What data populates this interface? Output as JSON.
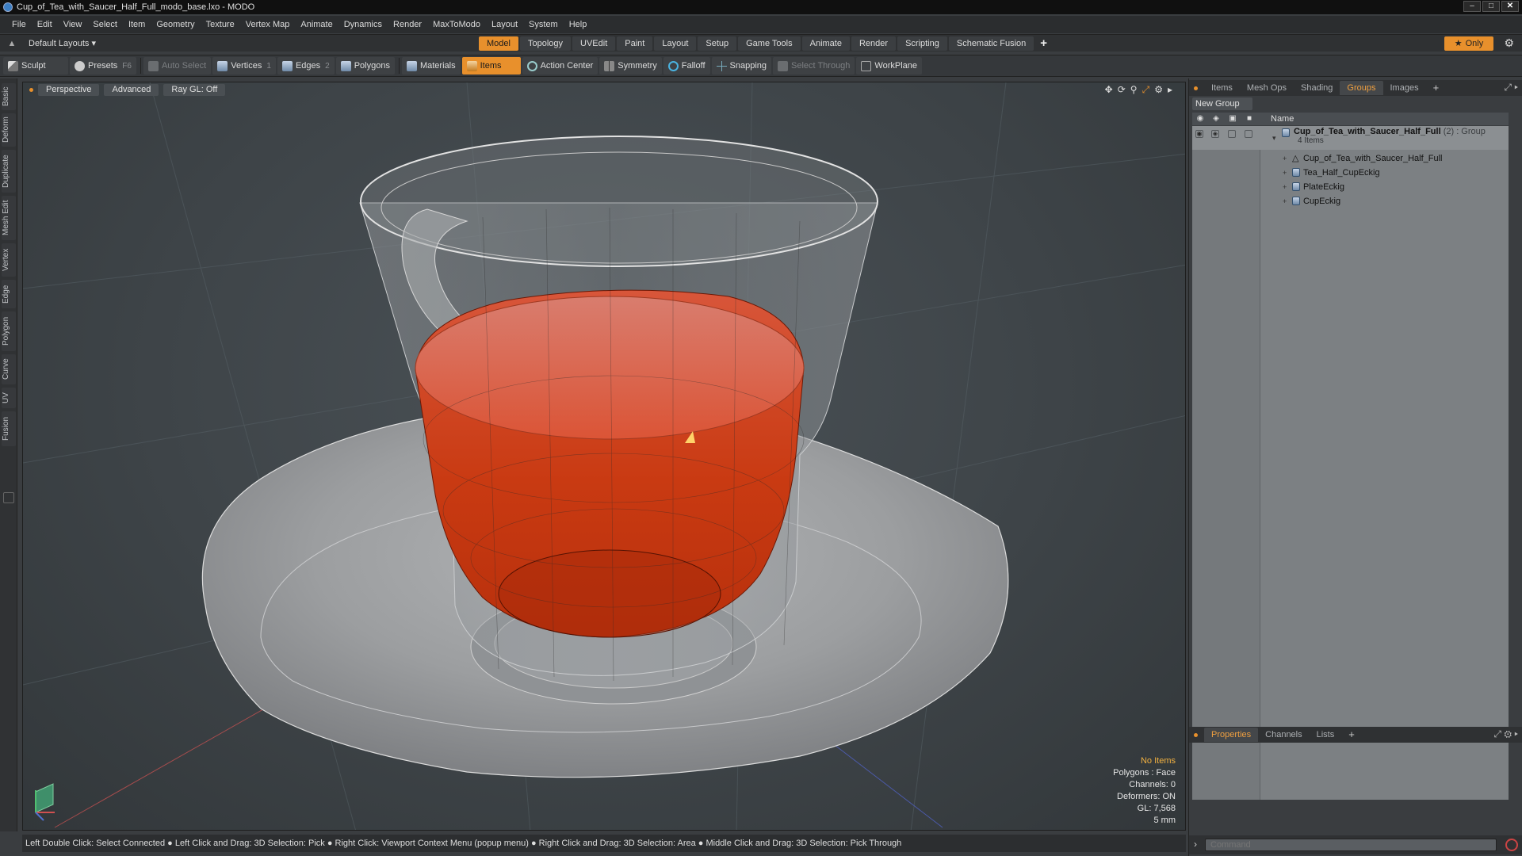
{
  "window": {
    "title": "Cup_of_Tea_with_Saucer_Half_Full_modo_base.lxo - MODO",
    "controls": [
      "–",
      "□",
      "✕"
    ]
  },
  "menubar": [
    "File",
    "Edit",
    "View",
    "Select",
    "Item",
    "Geometry",
    "Texture",
    "Vertex Map",
    "Animate",
    "Dynamics",
    "Render",
    "MaxToModo",
    "Layout",
    "System",
    "Help"
  ],
  "layout_selector": "Default Layouts ▾",
  "mode_tabs": [
    {
      "label": "Model",
      "active": true
    },
    {
      "label": "Topology",
      "active": false
    },
    {
      "label": "UVEdit",
      "active": false
    },
    {
      "label": "Paint",
      "active": false
    },
    {
      "label": "Layout",
      "active": false
    },
    {
      "label": "Setup",
      "active": false
    },
    {
      "label": "Game Tools",
      "active": false
    },
    {
      "label": "Animate",
      "active": false
    },
    {
      "label": "Render",
      "active": false
    },
    {
      "label": "Scripting",
      "active": false
    },
    {
      "label": "Schematic Fusion",
      "active": false
    }
  ],
  "tab_add": "+",
  "only_button": "Only",
  "toolbar": {
    "sculpt": "Sculpt",
    "presets": "Presets",
    "presets_key": "F6",
    "auto_select": "Auto Select",
    "vertices": "Vertices",
    "vertices_key": "1",
    "edges": "Edges",
    "edges_key": "2",
    "polygons": "Polygons",
    "materials": "Materials",
    "items": "Items",
    "action_center": "Action Center",
    "symmetry": "Symmetry",
    "falloff": "Falloff",
    "snapping": "Snapping",
    "select_through": "Select Through",
    "workplane": "WorkPlane"
  },
  "left_tabs": [
    "Basic",
    "Deform",
    "Duplicate",
    "Mesh Edit",
    "Vertex",
    "Edge",
    "Polygon",
    "Curve",
    "UV",
    "Fusion"
  ],
  "viewport": {
    "view": "Perspective",
    "shading": "Advanced",
    "raygl": "Ray GL: Off",
    "stats": {
      "selection": "No Items",
      "polygons": "Polygons : Face",
      "channels": "Channels: 0",
      "deformers": "Deformers: ON",
      "gl": "GL: 7,568",
      "unit": "5 mm"
    }
  },
  "statusbar": "Left Double Click: Select Connected ● Left Click and Drag: 3D Selection: Pick ● Right Click: Viewport Context Menu (popup menu) ● Right Click and Drag: 3D Selection: Area ● Middle Click and Drag: 3D Selection: Pick Through",
  "right_panel": {
    "top_tabs": [
      {
        "label": "Items",
        "active": false
      },
      {
        "label": "Mesh Ops",
        "active": false
      },
      {
        "label": "Shading",
        "active": false
      },
      {
        "label": "Groups",
        "active": true
      },
      {
        "label": "Images",
        "active": false
      }
    ],
    "new_group": "New Group",
    "name_header": "Name",
    "group": {
      "name": "Cup_of_Tea_with_Saucer_Half_Full",
      "meta": "(2) : Group",
      "count": "4 Items"
    },
    "items": [
      "Cup_of_Tea_with_Saucer_Half_Full",
      "Tea_Half_CupEckig",
      "PlateEckig",
      "CupEckig"
    ],
    "bottom_tabs": [
      {
        "label": "Properties",
        "active": true
      },
      {
        "label": "Channels",
        "active": false
      },
      {
        "label": "Lists",
        "active": false
      }
    ],
    "command_placeholder": "Command"
  },
  "colors": {
    "accent": "#e8902c",
    "tea": "#c83a12",
    "background": "#3a3d40"
  }
}
